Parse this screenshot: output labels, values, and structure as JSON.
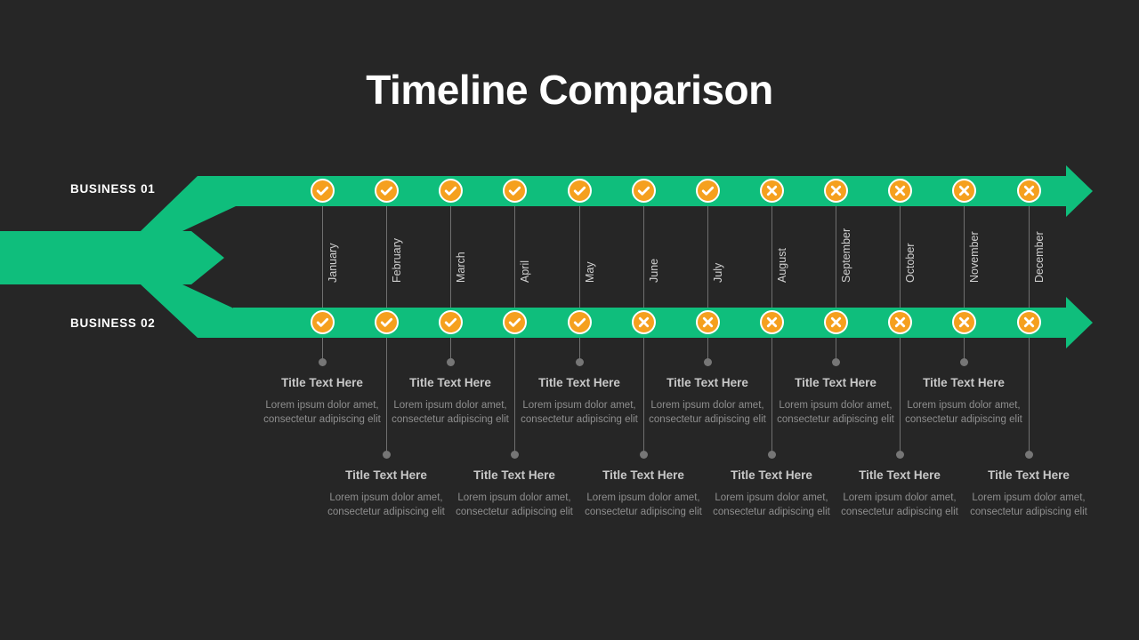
{
  "slide": {
    "title": "Timeline Comparison",
    "background_color": "#262626",
    "track_color": "#0FBE7C",
    "icon_color": "#F5A01E",
    "line_color": "#6F6F6F"
  },
  "tracks": [
    {
      "id": "business-01",
      "label": "BUSINESS 01"
    },
    {
      "id": "business-02",
      "label": "BUSINESS 02"
    }
  ],
  "months": [
    "January",
    "February",
    "March",
    "April",
    "May",
    "June",
    "July",
    "August",
    "September",
    "October",
    "November",
    "December"
  ],
  "milestones": {
    "business_01": [
      "check",
      "check",
      "check",
      "check",
      "check",
      "check",
      "check",
      "cross",
      "cross",
      "cross",
      "cross",
      "cross"
    ],
    "business_02": [
      "check",
      "check",
      "check",
      "check",
      "check",
      "cross",
      "cross",
      "cross",
      "cross",
      "cross",
      "cross",
      "cross"
    ]
  },
  "cards_upper": [
    {
      "title": "Title Text Here",
      "body": "Lorem ipsum dolor amet, consectetur adipiscing elit"
    },
    {
      "title": "Title Text Here",
      "body": "Lorem ipsum dolor amet, consectetur adipiscing elit"
    },
    {
      "title": "Title Text Here",
      "body": "Lorem ipsum dolor amet, consectetur adipiscing elit"
    },
    {
      "title": "Title Text Here",
      "body": "Lorem ipsum dolor amet, consectetur adipiscing elit"
    },
    {
      "title": "Title Text Here",
      "body": "Lorem ipsum dolor amet, consectetur adipiscing elit"
    },
    {
      "title": "Title Text Here",
      "body": "Lorem ipsum dolor amet, consectetur adipiscing elit"
    }
  ],
  "cards_lower": [
    {
      "title": "Title Text Here",
      "body": "Lorem ipsum dolor amet, consectetur adipiscing elit"
    },
    {
      "title": "Title Text Here",
      "body": "Lorem ipsum dolor amet, consectetur adipiscing elit"
    },
    {
      "title": "Title Text Here",
      "body": "Lorem ipsum dolor amet, consectetur adipiscing elit"
    },
    {
      "title": "Title Text Here",
      "body": "Lorem ipsum dolor amet, consectetur adipiscing elit"
    },
    {
      "title": "Title Text Here",
      "body": "Lorem ipsum dolor amet, consectetur adipiscing elit"
    },
    {
      "title": "Title Text Here",
      "body": "Lorem ipsum dolor amet, consectetur adipiscing elit"
    }
  ]
}
